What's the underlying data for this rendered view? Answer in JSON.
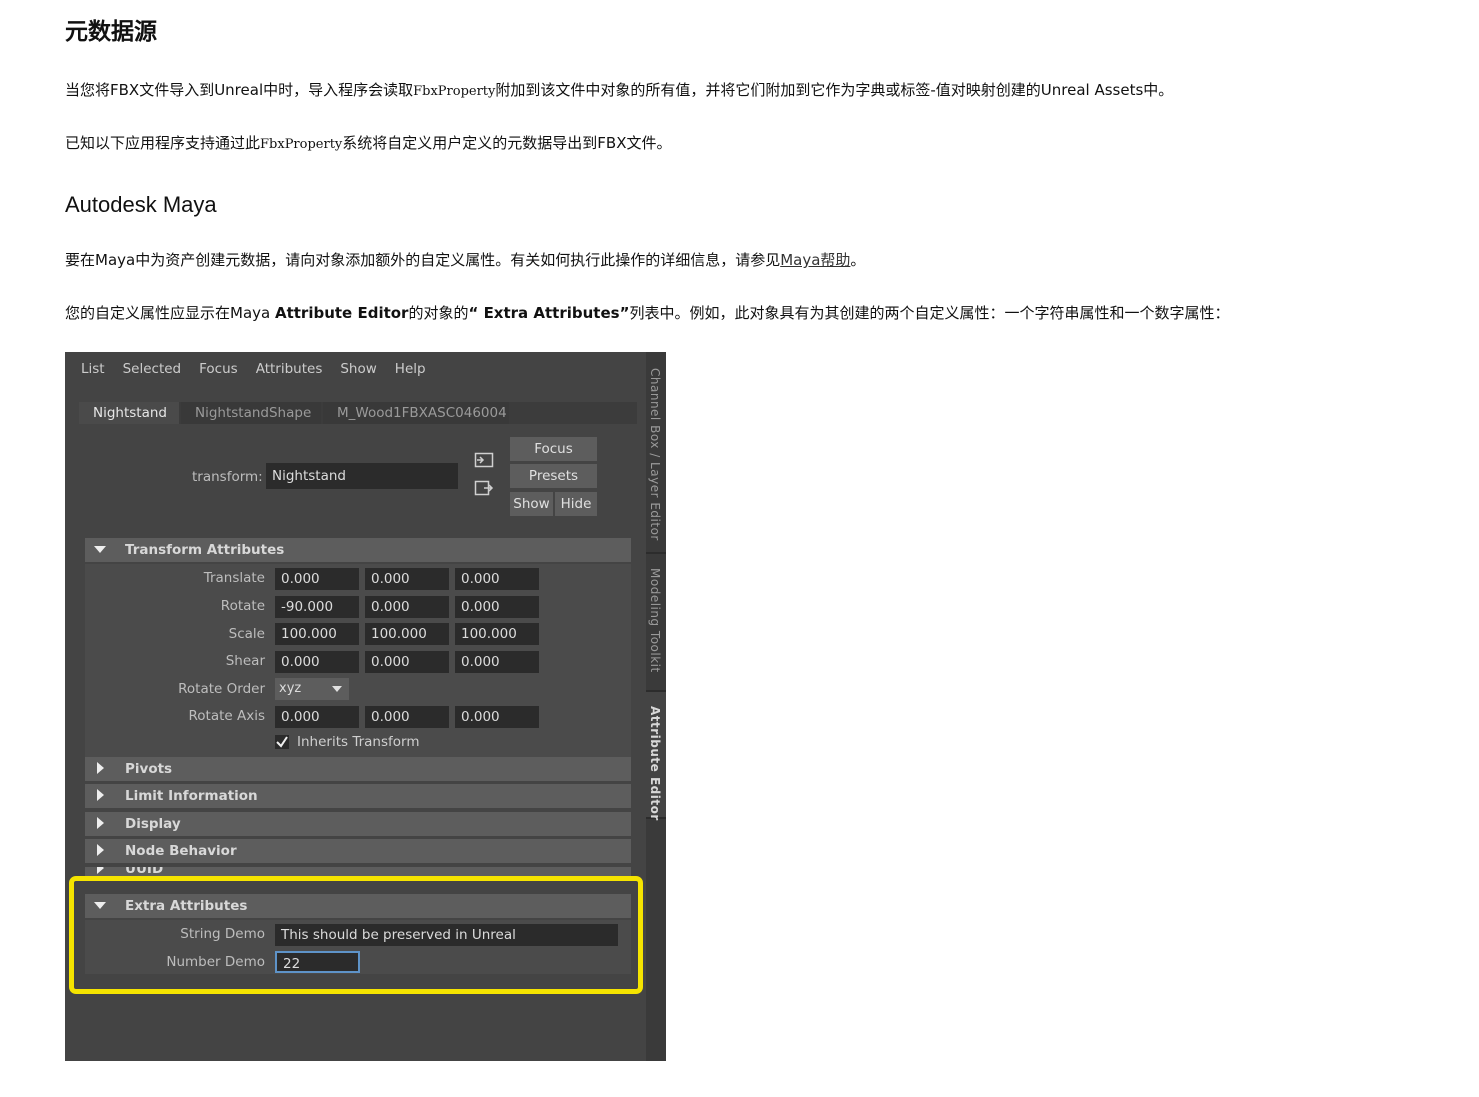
{
  "doc": {
    "title": "元数据源",
    "para1": {
      "before": "当您将FBX文件导入到Unreal中时，导入程序会读取",
      "code": "FbxProperty",
      "after": "附加到该文件中对象的所有值，并将它们附加到它作为字典或标签-值对映射创建的Unreal Assets中。"
    },
    "para2": {
      "before": "已知以下应用程序支持通过此",
      "code": "FbxProperty",
      "after": "系统将自定义用户定义的元数据导出到FBX文件。"
    },
    "subtitle": "Autodesk Maya",
    "para3": {
      "before": "要在Maya中为资产创建元数据，请向对象添加额外的自定义属性。有关如何执行此操作的详细信息，请参见",
      "link": "Maya帮助",
      "after": "。"
    },
    "para4": {
      "before": "您的自定义属性应显示在Maya ",
      "bold1": "Attribute Editor",
      "mid": "的对象的",
      "bold2": "“ Extra Attributes”",
      "after": "列表中。例如，此对象具有为其创建的两个自定义属性：一个字符串属性和一个数字属性："
    }
  },
  "maya": {
    "menu": [
      "List",
      "Selected",
      "Focus",
      "Attributes",
      "Show",
      "Help"
    ],
    "tabs": [
      "Nightstand",
      "NightstandShape",
      "M_Wood1FBXASC046004"
    ],
    "side_tabs": [
      "Channel Box / Layer Editor",
      "Modeling Toolkit",
      "Attribute Editor"
    ],
    "transform_label": "transform:",
    "transform_value": "Nightstand",
    "buttons": {
      "focus": "Focus",
      "presets": "Presets",
      "show": "Show",
      "hide": "Hide"
    },
    "transform_section": "Transform Attributes",
    "rows": [
      {
        "label": "Translate",
        "values": [
          "0.000",
          "0.000",
          "0.000"
        ]
      },
      {
        "label": "Rotate",
        "values": [
          "-90.000",
          "0.000",
          "0.000"
        ]
      },
      {
        "label": "Scale",
        "values": [
          "100.000",
          "100.000",
          "100.000"
        ]
      },
      {
        "label": "Shear",
        "values": [
          "0.000",
          "0.000",
          "0.000"
        ]
      }
    ],
    "rotate_order_label": "Rotate Order",
    "rotate_order_value": "xyz",
    "rotate_axis_label": "Rotate Axis",
    "rotate_axis_values": [
      "0.000",
      "0.000",
      "0.000"
    ],
    "inherits_transform": "Inherits Transform",
    "collapsed_sections": [
      "Pivots",
      "Limit Information",
      "Display",
      "Node Behavior",
      "UUID"
    ],
    "extra_section": "Extra Attributes",
    "string_demo_label": "String Demo",
    "string_demo_value": "This should be preserved in Unreal",
    "number_demo_label": "Number Demo",
    "number_demo_value": "22",
    "colors": {
      "highlight": "#f5e400",
      "panel": "#444444"
    }
  }
}
